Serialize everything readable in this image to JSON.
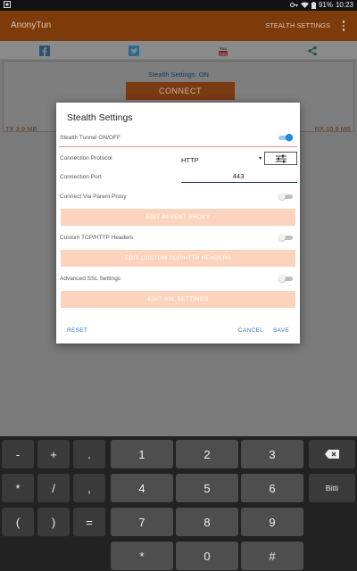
{
  "status_bar": {
    "battery": "91%",
    "time": "10:23"
  },
  "app_bar": {
    "title": "AnonyTun",
    "action": "STEALTH SETTINGS"
  },
  "social": {
    "icons": [
      "facebook-icon",
      "twitter-icon",
      "youtube-icon",
      "share-icon"
    ]
  },
  "main": {
    "stealth_status": "Stealth Settings: ON",
    "connect_label": "CONNECT",
    "tx": "TX 3,9 MB",
    "rx": "RX 10,9 MB"
  },
  "dialog": {
    "title": "Stealth Settings",
    "stealth_tunnel_label": "Stealth Tunnel ON/OFF",
    "stealth_tunnel_on": true,
    "protocol_label": "Connection Protocol",
    "protocol_value": "HTTP",
    "port_label": "Connection Port",
    "port_value": "443",
    "parent_proxy_label": "Connect Via Parent Proxy",
    "parent_proxy_on": false,
    "edit_parent_proxy": "EDIT PARENT PROXY",
    "custom_headers_label": "Custom TCP/HTTP Headers",
    "custom_headers_on": false,
    "edit_custom_headers": "EDIT CUSTOM TCP/HTTP HEADERS",
    "advanced_ssl_label": "Advanced SSL Settings",
    "advanced_ssl_on": false,
    "edit_ssl": "EDIT SSL SETTINGS",
    "reset": "RESET",
    "cancel": "CANCEL",
    "save": "SAVE"
  },
  "keypad": {
    "row1": [
      "-",
      "+",
      ".",
      "1",
      "2",
      "3"
    ],
    "row2": [
      "*",
      "/",
      ",",
      "4",
      "5",
      "6"
    ],
    "row3": [
      "(",
      ")",
      "=",
      "7",
      "8",
      "9"
    ],
    "row4": [
      "*",
      "0",
      "#"
    ],
    "done": "Bitti"
  },
  "colors": {
    "app_bar": "#7d3a0a",
    "accent_blue": "#1e88e5",
    "peach": "#fcd3bd",
    "link_blue": "#3d6fb3"
  }
}
